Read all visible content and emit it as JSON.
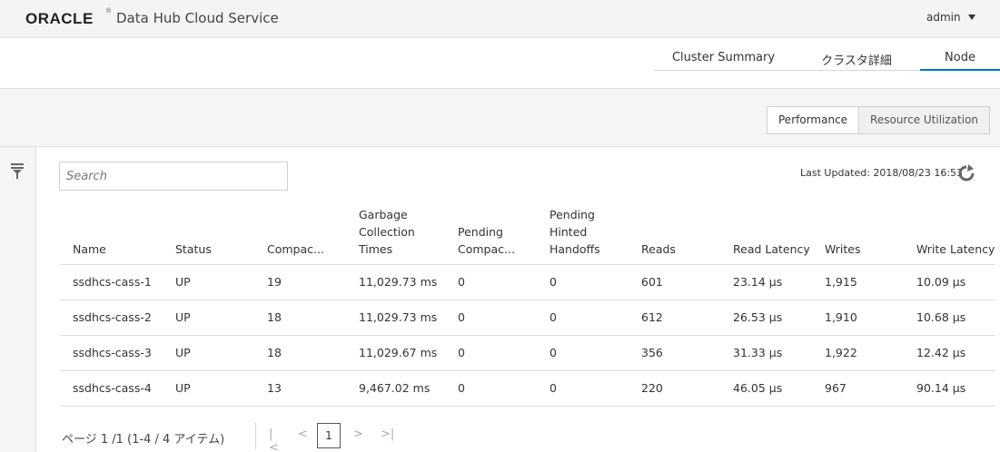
{
  "header": {
    "logo": "ORACLE",
    "logo_mark": "®",
    "app_title": "Data Hub Cloud Service",
    "user": "admin"
  },
  "top_tabs": [
    {
      "label": "Cluster Summary"
    },
    {
      "label": "クラスタ詳細"
    },
    {
      "label": "Node",
      "active": true
    }
  ],
  "view_toggle": {
    "performance": "Performance",
    "resource": "Resource Utilization",
    "active": "Performance"
  },
  "search": {
    "placeholder": "Search",
    "value": ""
  },
  "last_updated": "Last Updated: 2018/08/23 16:53",
  "table": {
    "columns": [
      "Name",
      "Status",
      "Compac...",
      "Garbage Collection Times",
      "Pending Compac...",
      "Pending Hinted Handoffs",
      "Reads",
      "Read Latency",
      "Writes",
      "Write Latency"
    ],
    "rows": [
      [
        "ssdhcs-cass-1",
        "UP",
        "19",
        "11,029.73 ms",
        "0",
        "0",
        "601",
        "23.14 µs",
        "1,915",
        "10.09 µs"
      ],
      [
        "ssdhcs-cass-2",
        "UP",
        "18",
        "11,029.73 ms",
        "0",
        "0",
        "612",
        "26.53 µs",
        "1,910",
        "10.68 µs"
      ],
      [
        "ssdhcs-cass-3",
        "UP",
        "18",
        "11,029.67 ms",
        "0",
        "0",
        "356",
        "31.33 µs",
        "1,922",
        "12.42 µs"
      ],
      [
        "ssdhcs-cass-4",
        "UP",
        "13",
        "9,467.02 ms",
        "0",
        "0",
        "220",
        "46.05 µs",
        "967",
        "90.14 µs"
      ]
    ]
  },
  "pagination": {
    "label": "ページ  1 /1   (1-4 / 4 アイテム)",
    "current_page": "1",
    "first": "|<",
    "prev": "<",
    "next": ">",
    "last": ">|"
  },
  "colors": {
    "accent": "#0572ce",
    "header_bg": "#f4f4f4",
    "band_bg": "#f5f5f5"
  },
  "icons": {
    "filter": "filter-icon",
    "refresh": "refresh-icon",
    "caret": "chevron-down-icon"
  }
}
